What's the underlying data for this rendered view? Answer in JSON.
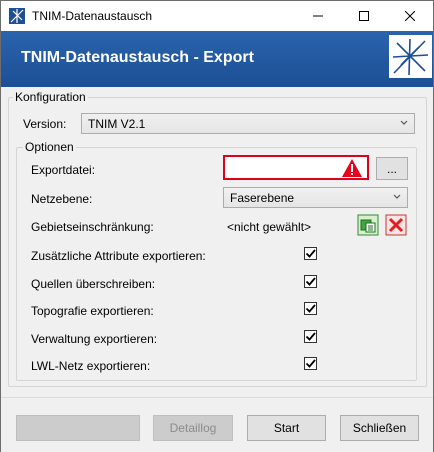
{
  "window": {
    "title": "TNIM-Datenaustausch",
    "controls": {
      "minimize": "—",
      "maximize": "☐",
      "close": "✕"
    }
  },
  "header": {
    "title": "TNIM-Datenaustausch - Export",
    "logo_icon": "network-star-logo"
  },
  "configuration": {
    "legend": "Konfiguration",
    "version_label": "Version:",
    "version_value": "TNIM V2.1"
  },
  "options": {
    "legend": "Optionen",
    "export_file_label": "Exportdatei:",
    "export_file_value": "",
    "browse_button": "...",
    "network_level_label": "Netzebene:",
    "network_level_value": "Faserebene",
    "area_restriction_label": "Gebietseinschränkung:",
    "area_restriction_value": "<nicht gewählt>",
    "checkboxes": [
      {
        "label": "Zusätzliche Attribute exportieren:",
        "checked": true
      },
      {
        "label": "Quellen überschreiben:",
        "checked": true
      },
      {
        "label": "Topografie exportieren:",
        "checked": true
      },
      {
        "label": "Verwaltung exportieren:",
        "checked": true
      },
      {
        "label": "LWL-Netz exportieren:",
        "checked": true
      }
    ]
  },
  "footer": {
    "progress": 0,
    "detaillog_button": "Detaillog",
    "start_button": "Start",
    "close_button": "Schließen"
  },
  "colors": {
    "banner": "#1c4f95",
    "error_border": "#e0001a",
    "warning": "#e8001c"
  }
}
